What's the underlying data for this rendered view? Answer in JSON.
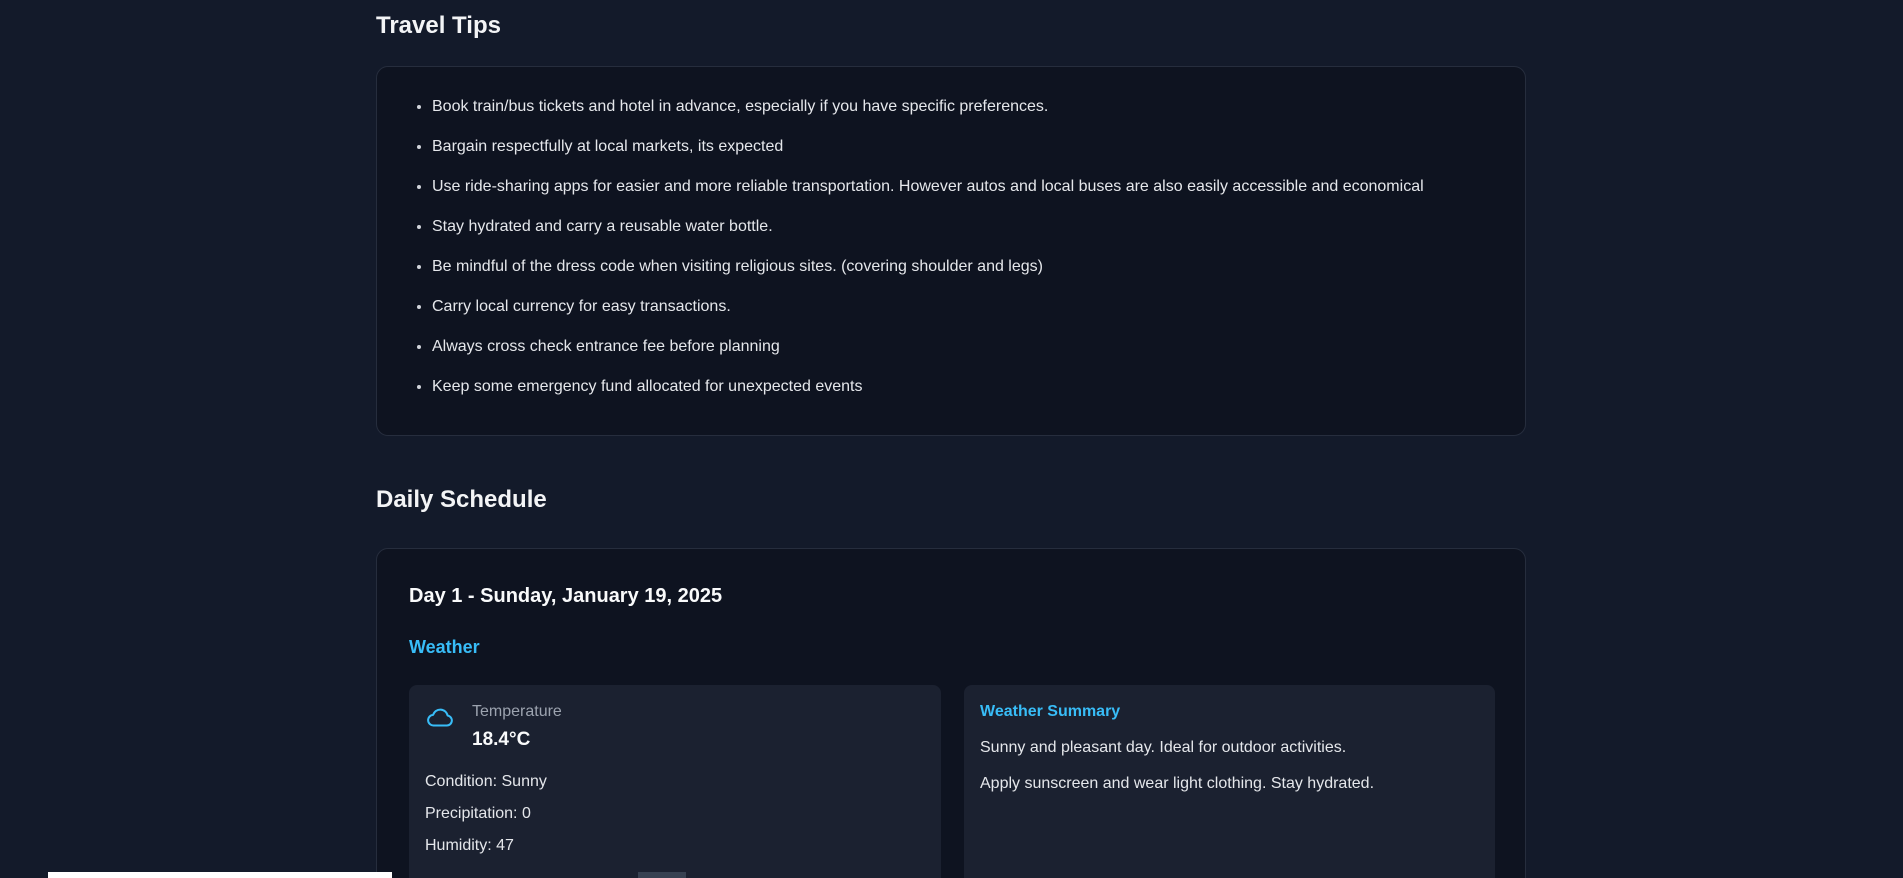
{
  "travel_tips": {
    "title": "Travel Tips",
    "items": [
      "Book train/bus tickets and hotel in advance, especially if you have specific preferences.",
      "Bargain respectfully at local markets, its expected",
      "Use ride-sharing apps for easier and more reliable transportation. However autos and local buses are also easily accessible and economical",
      "Stay hydrated and carry a reusable water bottle.",
      "Be mindful of the dress code when visiting religious sites. (covering shoulder and legs)",
      "Carry local currency for easy transactions.",
      "Always cross check entrance fee before planning",
      "Keep some emergency fund allocated for unexpected events"
    ]
  },
  "daily_schedule": {
    "title": "Daily Schedule",
    "day": {
      "title": "Day 1 - Sunday, January 19, 2025",
      "weather_heading": "Weather",
      "temperature_label": "Temperature",
      "temperature_value": "18.4°C",
      "condition": "Condition: Sunny",
      "precipitation": "Precipitation: 0",
      "humidity": "Humidity: 47",
      "summary_title": "Weather Summary",
      "summary_lines": [
        "Sunny and pleasant day. Ideal for outdoor activities.",
        "Apply sunscreen and wear light clothing. Stay hydrated."
      ],
      "icon": "cloud-icon"
    }
  },
  "colors": {
    "background": "#131a2a",
    "card": "#0e1320",
    "panel": "#1b2130",
    "accent": "#38bdf8"
  }
}
